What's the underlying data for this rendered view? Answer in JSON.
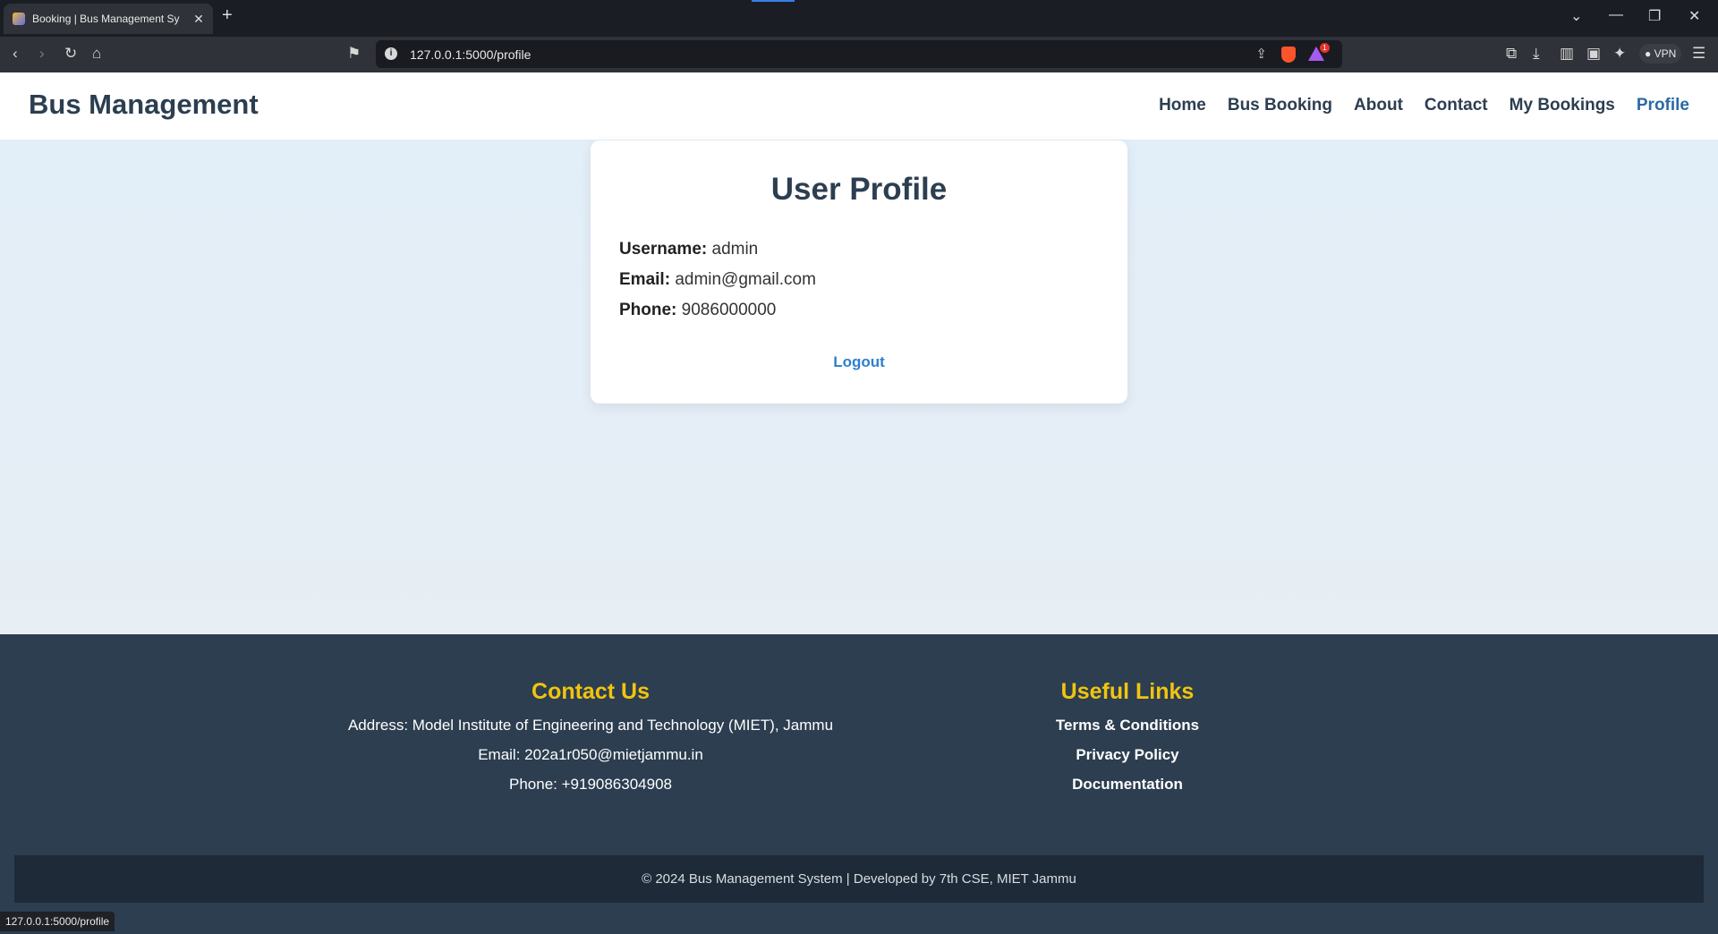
{
  "browser": {
    "tab_title": "Booking | Bus Management Sy",
    "new_tab": "+",
    "tab_close": "✕",
    "url": "127.0.0.1:5000/profile",
    "vpn_label": "VPN",
    "rewards_count": "1",
    "status_url": "127.0.0.1:5000/profile"
  },
  "header": {
    "brand": "Bus Management",
    "nav": {
      "home": "Home",
      "bus_booking": "Bus Booking",
      "about": "About",
      "contact": "Contact",
      "my_bookings": "My Bookings",
      "profile": "Profile"
    }
  },
  "profile": {
    "title": "User Profile",
    "username_label": "Username:",
    "username": "admin",
    "email_label": "Email:",
    "email": "admin@gmail.com",
    "phone_label": "Phone:",
    "phone": "9086000000",
    "logout": "Logout"
  },
  "footer": {
    "contact": {
      "heading": "Contact Us",
      "address": "Address: Model Institute of Engineering and Technology (MIET), Jammu",
      "email": "Email: 202a1r050@mietjammu.in",
      "phone": "Phone: +919086304908"
    },
    "links": {
      "heading": "Useful Links",
      "terms": "Terms & Conditions",
      "privacy": "Privacy Policy",
      "docs": "Documentation"
    },
    "copyright": "© 2024 Bus Management System | Developed by 7th CSE, MIET Jammu"
  },
  "colors": {
    "nav_text": "#2c3e50",
    "nav_active": "#2b6aa6",
    "footer_bg": "#2c3e50",
    "footer_heading": "#f1c40f",
    "link_blue": "#2e7fcf"
  }
}
